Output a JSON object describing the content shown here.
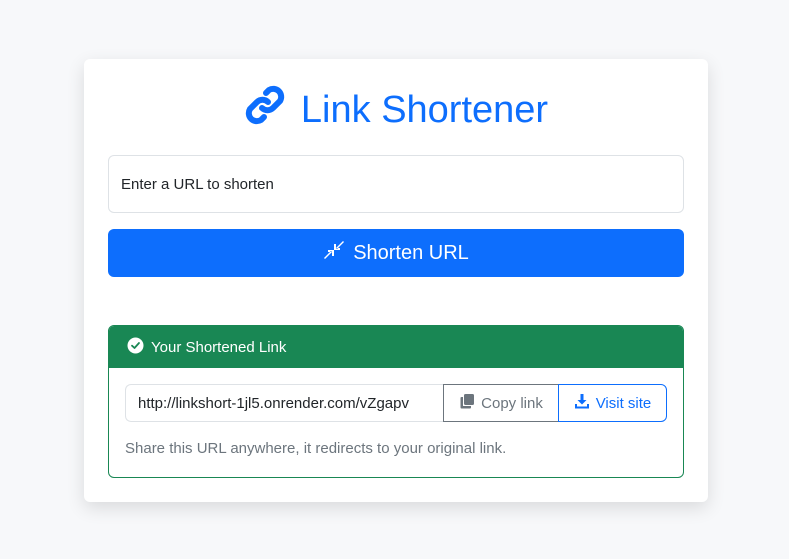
{
  "header": {
    "title": "Link Shortener",
    "icon": "link-icon"
  },
  "form": {
    "url_placeholder": "Enter a URL to shorten",
    "url_value": "",
    "submit_label": "Shorten URL",
    "submit_icon": "compress-icon"
  },
  "result": {
    "header_label": "Your Shortened Link",
    "header_icon": "check-circle-icon",
    "short_url": "http://linkshort-1jl5.onrender.com/vZgapv",
    "copy_label": "Copy link",
    "copy_icon": "copy-icon",
    "visit_label": "Visit site",
    "visit_icon": "download-icon",
    "hint": "Share this URL anywhere, it redirects to your original link."
  },
  "colors": {
    "primary": "#0d6efd",
    "success": "#198754",
    "secondary": "#6c757d",
    "background": "#f7f8fa"
  }
}
